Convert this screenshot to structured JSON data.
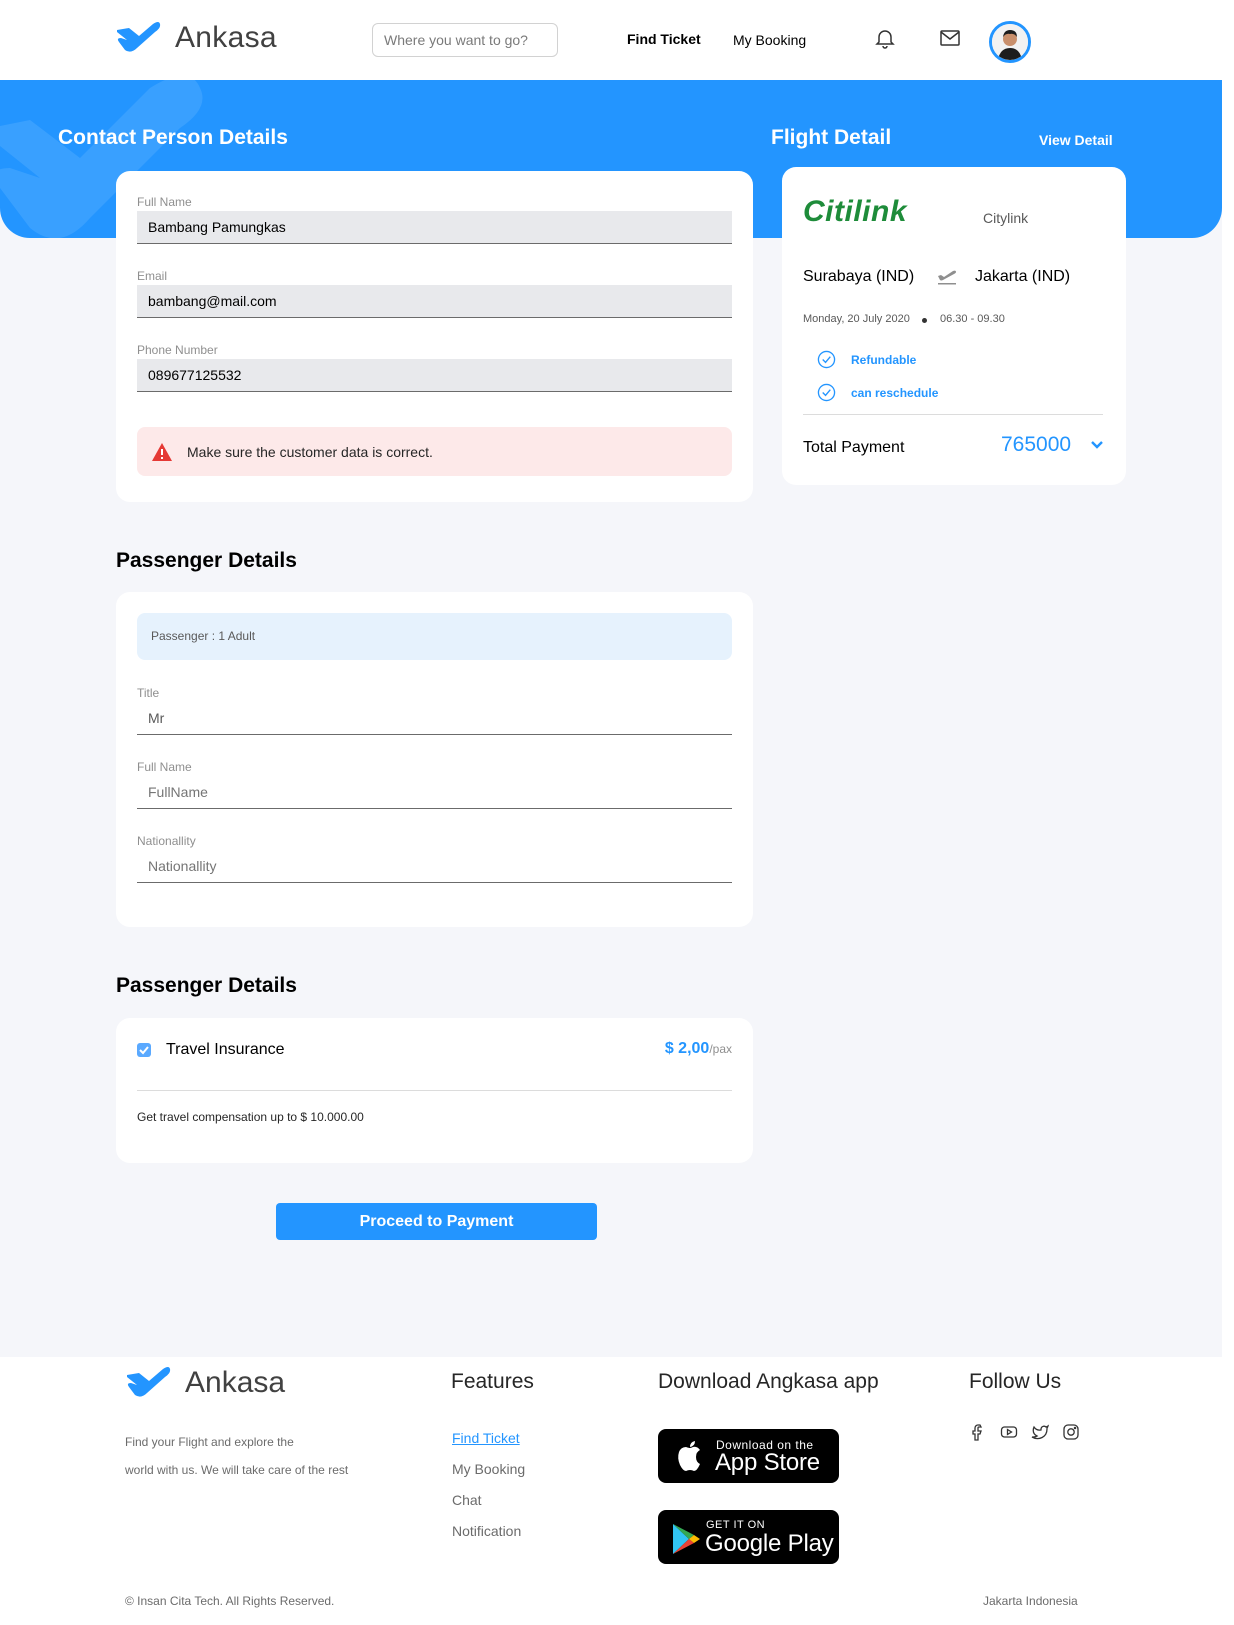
{
  "brand": {
    "name": "Ankasa",
    "color": "#2395ff"
  },
  "header": {
    "search_placeholder": "Where you want to go?",
    "nav": {
      "find_ticket": "Find Ticket",
      "my_booking": "My Booking"
    }
  },
  "band": {
    "contact_title": "Contact Person Details",
    "flight_title": "Flight Detail",
    "view_detail": "View Detail"
  },
  "contact": {
    "full_name_label": "Full Name",
    "full_name_value": "Bambang Pamungkas",
    "email_label": "Email",
    "email_value": "bambang@mail.com",
    "phone_label": "Phone Number",
    "phone_value": "089677125532",
    "alert": "Make sure the customer data is correct."
  },
  "passenger": {
    "heading": "Passenger Details",
    "count_text": "Passenger : 1 Adult",
    "title_label": "Title",
    "title_value": "Mr",
    "fullname_label": "Full Name",
    "fullname_placeholder": "FullName",
    "nationality_label": "Nationallity",
    "nationality_placeholder": "Nationallity"
  },
  "insurance": {
    "heading": "Passenger Details",
    "label": "Travel Insurance",
    "checked": true,
    "price": "$ 2,00",
    "price_unit": "/pax",
    "note": "Get travel compensation up to $ 10.000.00"
  },
  "proceed_label": "Proceed to Payment",
  "flight": {
    "airline_logo_text": "Citilink",
    "airline_name": "Citylink",
    "from": "Surabaya (IND)",
    "to": "Jakarta (IND)",
    "date": "Monday, 20 July 2020",
    "time": "06.30 - 09.30",
    "features": [
      "Refundable",
      "can reschedule"
    ],
    "total_label": "Total Payment",
    "total_value": "765000"
  },
  "footer": {
    "brand": "Ankasa",
    "desc_line1": "Find your Flight and explore the",
    "desc_line2": "world with us. We will take care of the rest",
    "features_title": "Features",
    "features": [
      "Find Ticket",
      "My Booking",
      "Chat",
      "Notification"
    ],
    "download_title": "Download Angkasa app",
    "appstore_top": "Download on the",
    "appstore_main": "App Store",
    "googleplay_top": "GET IT ON",
    "googleplay_main": "Google Play",
    "follow_title": "Follow Us",
    "social_icons": [
      "facebook-icon",
      "youtube-icon",
      "twitter-icon",
      "instagram-icon"
    ],
    "copyright": "© Insan Cita Tech. All Rights Reserved.",
    "location": "Jakarta Indonesia"
  }
}
